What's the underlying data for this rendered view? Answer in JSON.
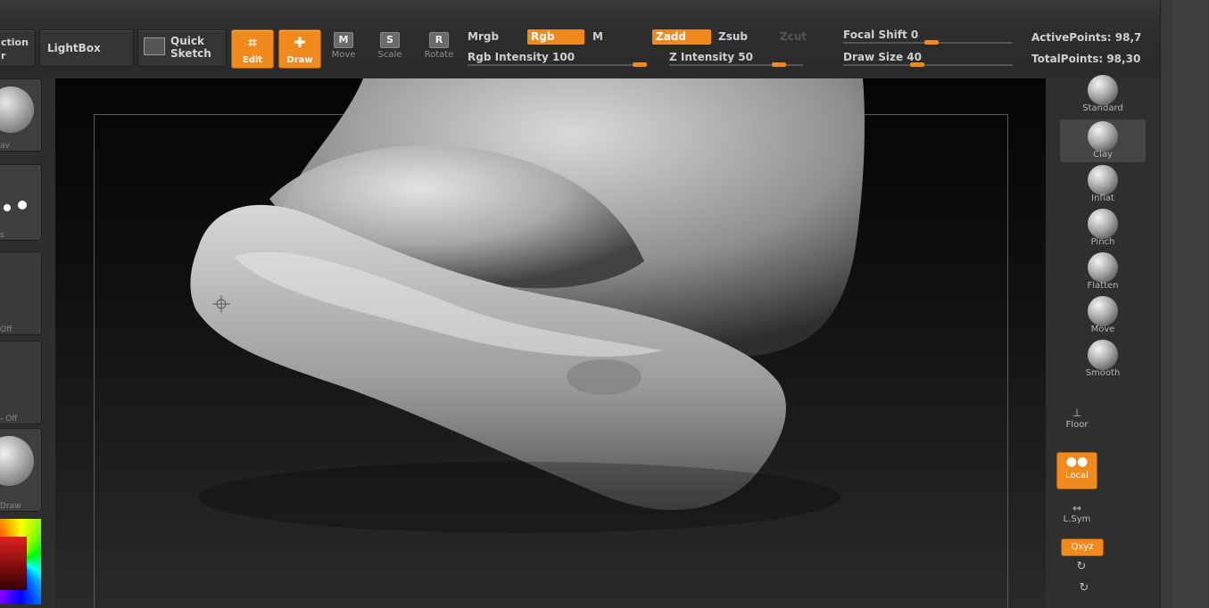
{
  "colors": {
    "accent": "#f08a1c",
    "panel": "#2e2e2e",
    "canvas": "#0a0a0a"
  },
  "toolbar": {
    "section_label": "ction",
    "section_sub": "r",
    "lightbox": "LightBox",
    "quick_sketch_line1": "Quick",
    "quick_sketch_line2": "Sketch",
    "edit": "Edit",
    "draw": "Draw",
    "move": "Move",
    "scale": "Scale",
    "rotate": "Rotate",
    "move_key": "M",
    "scale_key": "S",
    "rotate_key": "R",
    "mrgb": "Mrgb",
    "rgb": "Rgb",
    "m": "M",
    "rgb_intensity": "Rgb Intensity 100",
    "rgb_intensity_value": 100,
    "zadd": "Zadd",
    "zsub": "Zsub",
    "zcut": "Zcut",
    "z_intensity": "Z Intensity 50",
    "z_intensity_value": 50,
    "focal_shift": "Focal Shift 0",
    "focal_shift_value": 0,
    "draw_size": "Draw Size 40",
    "draw_size_value": 40,
    "active_points": "ActivePoints: 98,7",
    "total_points": "TotalPoints: 98,30"
  },
  "left_panel": {
    "captions": [
      "av",
      "s",
      "Off",
      "- Off",
      "Draw"
    ]
  },
  "brushes": [
    {
      "label": "Standard",
      "active": false
    },
    {
      "label": "Clay",
      "active": true
    },
    {
      "label": "Inflat",
      "active": false
    },
    {
      "label": "Pinch",
      "active": false
    },
    {
      "label": "Flatten",
      "active": false
    },
    {
      "label": "Move",
      "active": false
    },
    {
      "label": "Smooth",
      "active": false
    }
  ],
  "shelf": {
    "floor": "Floor",
    "local": "Local",
    "lsym": "L.Sym",
    "qxyz": "Qxyz"
  }
}
